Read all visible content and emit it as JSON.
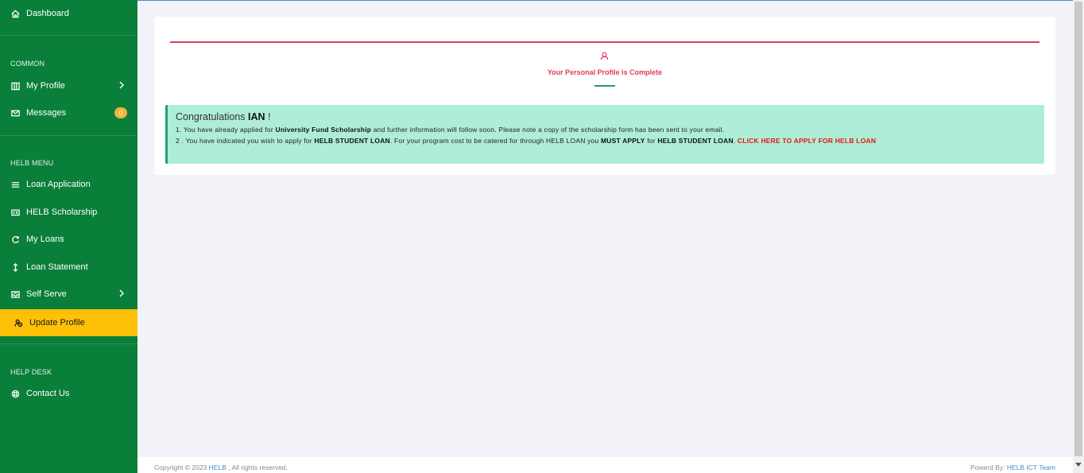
{
  "sidebar": {
    "dashboard": "Dashboard",
    "common_label": "COMMON",
    "my_profile": "My Profile",
    "messages": "Messages",
    "messages_badge": "0",
    "helb_menu_label": "HELB MENU",
    "loan_application": "Loan Application",
    "helb_scholarship": "HELB Scholarship",
    "my_loans": "My Loans",
    "loan_statement": "Loan Statement",
    "self_serve": "Self Serve",
    "update_profile": "Update Profile",
    "help_desk_label": "HELP DESK",
    "contact_us": "Contact Us",
    "icons": [
      "home-icon",
      "columns-icon",
      "mail-icon",
      "menu-icon",
      "card-icon",
      "refresh-icon",
      "updown-icon",
      "inbox-icon",
      "users-icon",
      "lifebuoy-icon"
    ]
  },
  "card": {
    "profile_status": "Your Personal Profile is Complete",
    "congrats_prefix": "Congratulations",
    "user_name": "IAN",
    "congrats_suffix": "!",
    "line1_prefix": "1. You have already applied for",
    "line1_bold": "University Fund Scholarship",
    "line1_suffix": "and further information will follow soon. Please note a copy of the scholarship form has been sent to your email.",
    "line2_prefix": "2 . You have indicated you wish to apply for",
    "line2_bold1": "HELB STUDENT LOAN",
    "line2_mid": ". For your program cost to be catered for through HELB LOAN you",
    "line2_bold2": "MUST APPLY",
    "line2_for": "for",
    "line2_bold3": "HELB STUDENT LOAN",
    "line2_link": "CLICK HERE TO APPLY FOR HELB LOAN"
  },
  "footer": {
    "copyright_prefix": "Copyright © 2023",
    "copyright_link": "HELB",
    "copyright_suffix": ", All rights reserved.",
    "powered_prefix": "Powerd By:",
    "powered_link": "HELB ICT Team"
  },
  "colors": {
    "sidebar_bg": "#0a7f3a",
    "active_bg": "#ffc107",
    "accent_red": "#e23a5a",
    "alert_bg": "#aeedd7",
    "link_red": "#e8141a"
  }
}
